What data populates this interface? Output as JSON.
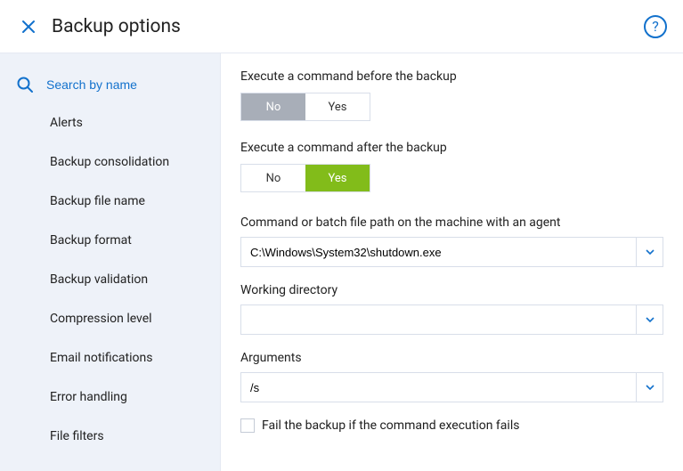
{
  "header": {
    "title": "Backup options"
  },
  "sidebar": {
    "search_placeholder": "Search by name",
    "items": [
      "Alerts",
      "Backup consolidation",
      "Backup file name",
      "Backup format",
      "Backup validation",
      "Compression level",
      "Email notifications",
      "Error handling",
      "File filters"
    ]
  },
  "main": {
    "before": {
      "label": "Execute a command before the backup",
      "no": "No",
      "yes": "Yes",
      "selected": "No"
    },
    "after": {
      "label": "Execute a command after the backup",
      "no": "No",
      "yes": "Yes",
      "selected": "Yes"
    },
    "command_path": {
      "label": "Command or batch file path on the machine with an agent",
      "value": "C:\\Windows\\System32\\shutdown.exe"
    },
    "working_dir": {
      "label": "Working directory",
      "value": ""
    },
    "arguments": {
      "label": "Arguments",
      "value": "/s"
    },
    "fail_checkbox": {
      "label": "Fail the backup if the command execution fails",
      "checked": false
    }
  }
}
